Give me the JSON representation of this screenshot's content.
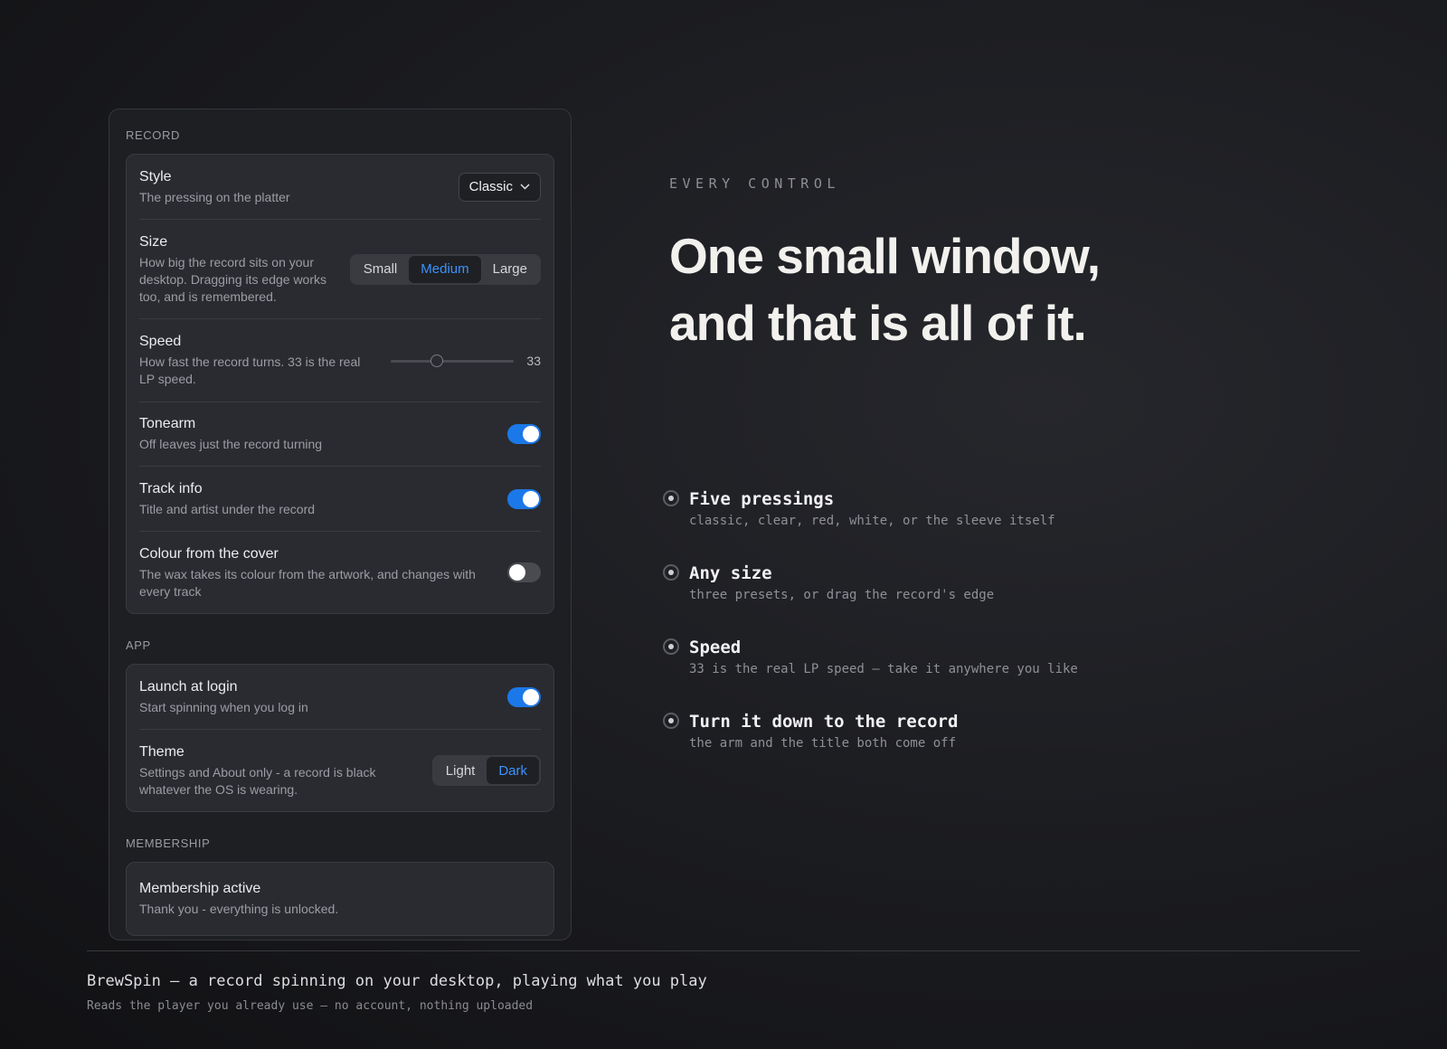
{
  "panel": {
    "record": {
      "label": "RECORD",
      "style": {
        "title": "Style",
        "desc": "The pressing on the platter",
        "value": "Classic"
      },
      "size": {
        "title": "Size",
        "desc": "How big the record sits on your desktop. Dragging its edge works too, and is remembered.",
        "options": [
          "Small",
          "Medium",
          "Large"
        ],
        "selected": "Medium"
      },
      "speed": {
        "title": "Speed",
        "desc": "How fast the record turns. 33 is the real LP speed.",
        "value": "33",
        "level": 0.375
      },
      "tonearm": {
        "title": "Tonearm",
        "desc": "Off leaves just the record turning",
        "on": true
      },
      "track_info": {
        "title": "Track info",
        "desc": "Title and artist under the record",
        "on": true
      },
      "cover_colour": {
        "title": "Colour from the cover",
        "desc": "The wax takes its colour from the artwork, and changes with every track",
        "on": false
      }
    },
    "app": {
      "label": "APP",
      "launch": {
        "title": "Launch at login",
        "desc": "Start spinning when you log in",
        "on": true
      },
      "theme": {
        "title": "Theme",
        "desc": "Settings and About only - a record is black whatever the OS is wearing.",
        "options": [
          "Light",
          "Dark"
        ],
        "selected": "Dark"
      }
    },
    "membership": {
      "label": "MEMBERSHIP",
      "title": "Membership active",
      "desc": "Thank you - everything is unlocked."
    }
  },
  "hero": {
    "eyebrow": "EVERY CONTROL",
    "headline_line1": "One small window,",
    "headline_line2": "and that is all of it."
  },
  "features": [
    {
      "title": "Five pressings",
      "desc": "classic, clear, red, white, or the sleeve itself"
    },
    {
      "title": "Any size",
      "desc": "three presets, or drag the record's edge"
    },
    {
      "title": "Speed",
      "desc": "33 is the real LP speed — take it anywhere you like"
    },
    {
      "title": "Turn it down to the record",
      "desc": "the arm and the title both come off"
    }
  ],
  "footer": {
    "title": "BrewSpin — a record spinning on your desktop, playing what you play",
    "subtitle": "Reads the player you already use — no account, nothing uploaded"
  },
  "colors": {
    "accent": "#1b78e8",
    "accent_text": "#3b93ff",
    "background": "#1c1d21"
  }
}
